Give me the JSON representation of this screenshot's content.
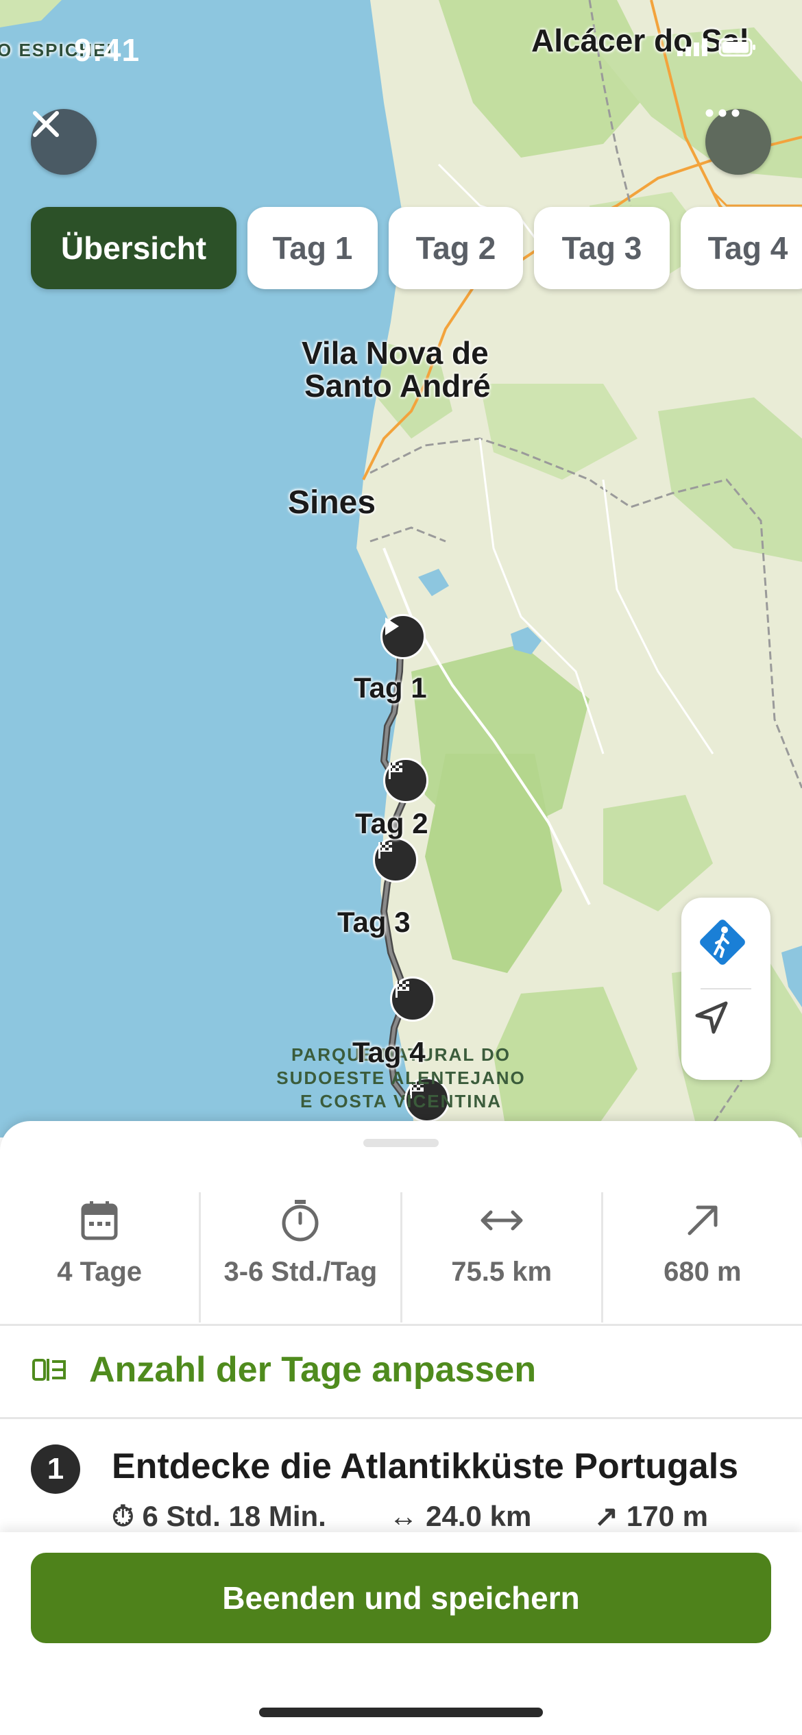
{
  "status": {
    "time": "9:41"
  },
  "tabs": [
    {
      "label": "Übersicht",
      "active": true
    },
    {
      "label": "Tag 1",
      "active": false
    },
    {
      "label": "Tag 2",
      "active": false
    },
    {
      "label": "Tag 3",
      "active": false
    },
    {
      "label": "Tag 4",
      "active": false
    }
  ],
  "map": {
    "places": {
      "alcacer": "Alcácer do Sal",
      "espichel": "O ESPICHEL",
      "vila_nova_1": "Vila Nova de",
      "vila_nova_2": "Santo André",
      "sines": "Sines"
    },
    "park": {
      "line1": "PARQUE NATURAL DO",
      "line2": "SUDOESTE ALENTEJANO",
      "line3": "E COSTA VICENTINA"
    },
    "route_labels": {
      "day1": "Tag 1",
      "day2": "Tag 2",
      "day3": "Tag 3",
      "day4": "Tag 4"
    }
  },
  "stats": {
    "days": "4 Tage",
    "duration": "3-6 Std./Tag",
    "distance": "75.5 km",
    "ascent": "680 m"
  },
  "adjust_days": {
    "label": "Anzahl der Tage anpassen"
  },
  "day_list": [
    {
      "number": "1",
      "title": "Entdecke die Atlantikküste Portugals",
      "duration": "6 Std. 18 Min.",
      "distance": "24.0 km",
      "ascent": "170 m"
    }
  ],
  "footer": {
    "save_label": "Beenden und speichern"
  },
  "colors": {
    "accent_green": "#4e821b",
    "tab_active": "#2c5128",
    "sea": "#8dc6df",
    "land": "#e9ecd6",
    "forest": "#bfdc9c"
  },
  "icons": [
    "close-icon",
    "more-icon",
    "hiking-icon",
    "locate-icon",
    "calendar-icon",
    "stopwatch-icon",
    "distance-icon",
    "ascent-icon",
    "adjust-days-icon"
  ]
}
